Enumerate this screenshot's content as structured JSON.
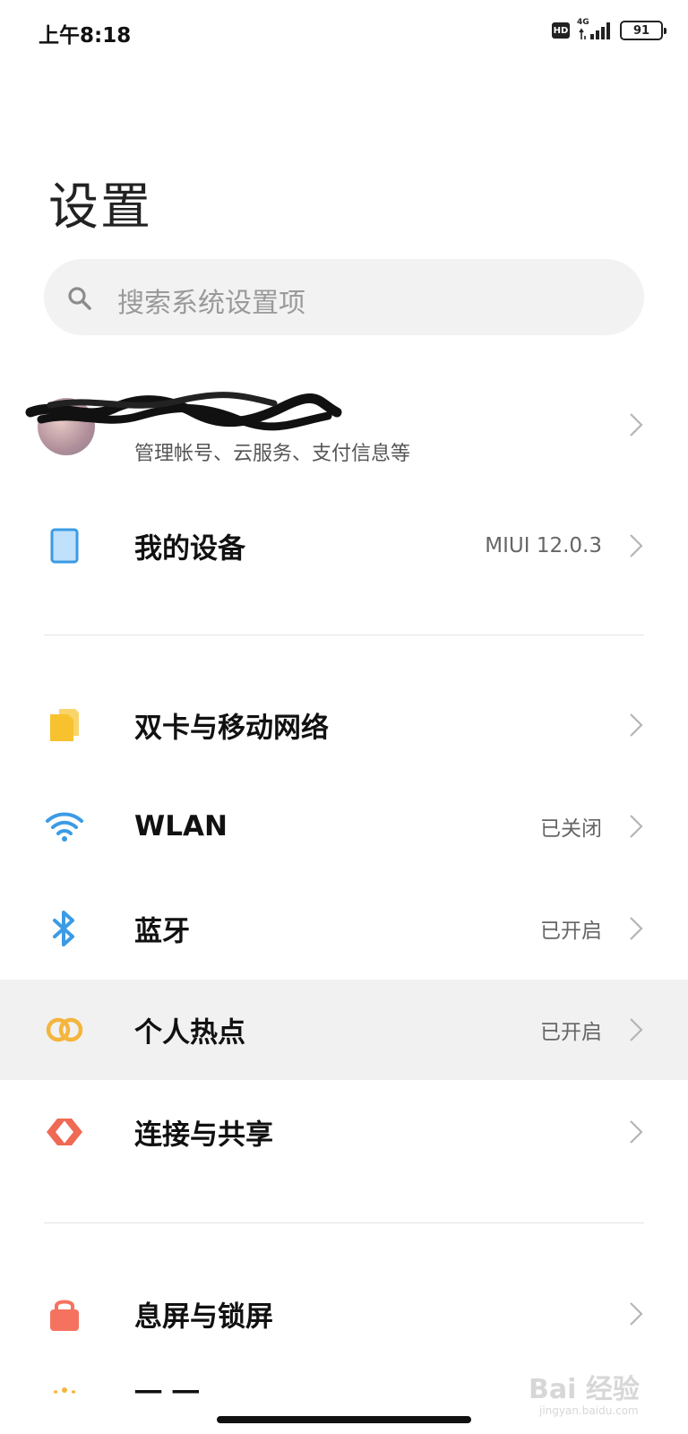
{
  "status_bar": {
    "time": "上午8:18",
    "hd": "HD",
    "network": "4G",
    "battery": "91"
  },
  "header": {
    "title": "设置"
  },
  "search": {
    "placeholder": "搜索系统设置项"
  },
  "account": {
    "subtitle": "管理帐号、云服务、支付信息等"
  },
  "items": [
    {
      "label": "我的设备",
      "value": "MIUI 12.0.3",
      "icon": "tablet-icon",
      "color": "#3b9be5"
    },
    {
      "label": "双卡与移动网络",
      "value": "",
      "icon": "sim-card-icon",
      "color": "#f7c22e"
    },
    {
      "label": "WLAN",
      "value": "已关闭",
      "icon": "wifi-icon",
      "color": "#3b9be5"
    },
    {
      "label": "蓝牙",
      "value": "已开启",
      "icon": "bluetooth-icon",
      "color": "#3b9be5"
    },
    {
      "label": "个人热点",
      "value": "已开启",
      "icon": "hotspot-icon",
      "color": "#f4b53d"
    },
    {
      "label": "连接与共享",
      "value": "",
      "icon": "share-icon",
      "color": "#ef6a55"
    },
    {
      "label": "息屏与锁屏",
      "value": "",
      "icon": "lock-icon",
      "color": "#f5735e"
    },
    {
      "label": "一 一",
      "value": "",
      "icon": "display-icon",
      "color": "#f4b53d"
    }
  ],
  "watermark": {
    "main": "Bai 经验",
    "sub": "jingyan.baidu.com"
  }
}
